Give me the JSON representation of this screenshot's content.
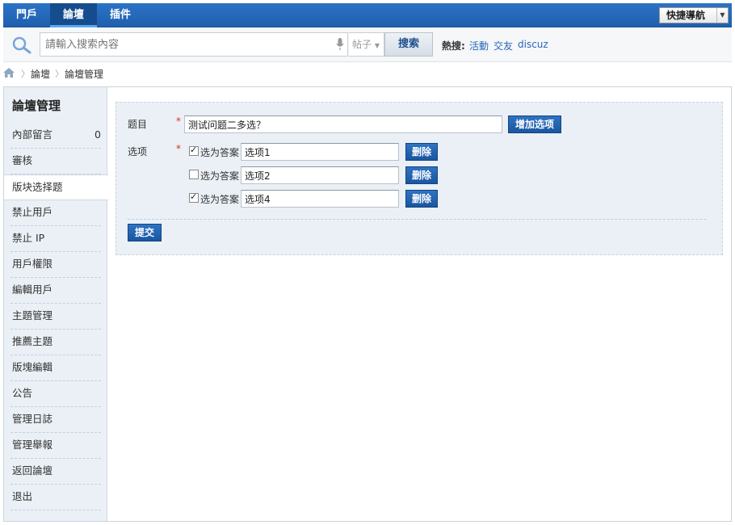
{
  "nav": {
    "items": [
      {
        "label": "門戶"
      },
      {
        "label": "論壇"
      },
      {
        "label": "插件"
      }
    ],
    "quick_nav_label": "快捷導航"
  },
  "search": {
    "placeholder": "請輸入搜索內容",
    "type": "帖子",
    "button": "搜索",
    "hot_label": "熱搜:",
    "hot_links": [
      "活動",
      "交友",
      "discuz"
    ]
  },
  "breadcrumb": {
    "items": [
      "論壇",
      "論壇管理"
    ]
  },
  "sidebar": {
    "title": "論壇管理",
    "items": [
      {
        "label": "內部留言",
        "count": "0"
      },
      {
        "label": "審核"
      },
      {
        "label": "版块选择题"
      },
      {
        "label": "禁止用戶"
      },
      {
        "label": "禁止 IP"
      },
      {
        "label": "用戶權限"
      },
      {
        "label": "編輯用戶"
      },
      {
        "label": "主題管理"
      },
      {
        "label": "推薦主題"
      },
      {
        "label": "版塊編輯"
      },
      {
        "label": "公告"
      },
      {
        "label": "管理日誌"
      },
      {
        "label": "管理舉報"
      },
      {
        "label": "返回論壇"
      },
      {
        "label": "退出"
      }
    ]
  },
  "form": {
    "question_label": "题目",
    "question_value": "测试问题二多选？",
    "add_option_button": "增加选项",
    "options_label": "选项",
    "answer_label": "选为答案",
    "delete_button": "删除",
    "options": [
      {
        "value": "选项1",
        "checked": true
      },
      {
        "value": "选项2",
        "checked": false
      },
      {
        "value": "选项4",
        "checked": true
      }
    ],
    "submit_button": "提交"
  },
  "colors": {
    "nav_bg": "#2b73c6",
    "button_blue": "#1b56a0",
    "link": "#2b66b8",
    "required": "#d9321f"
  }
}
